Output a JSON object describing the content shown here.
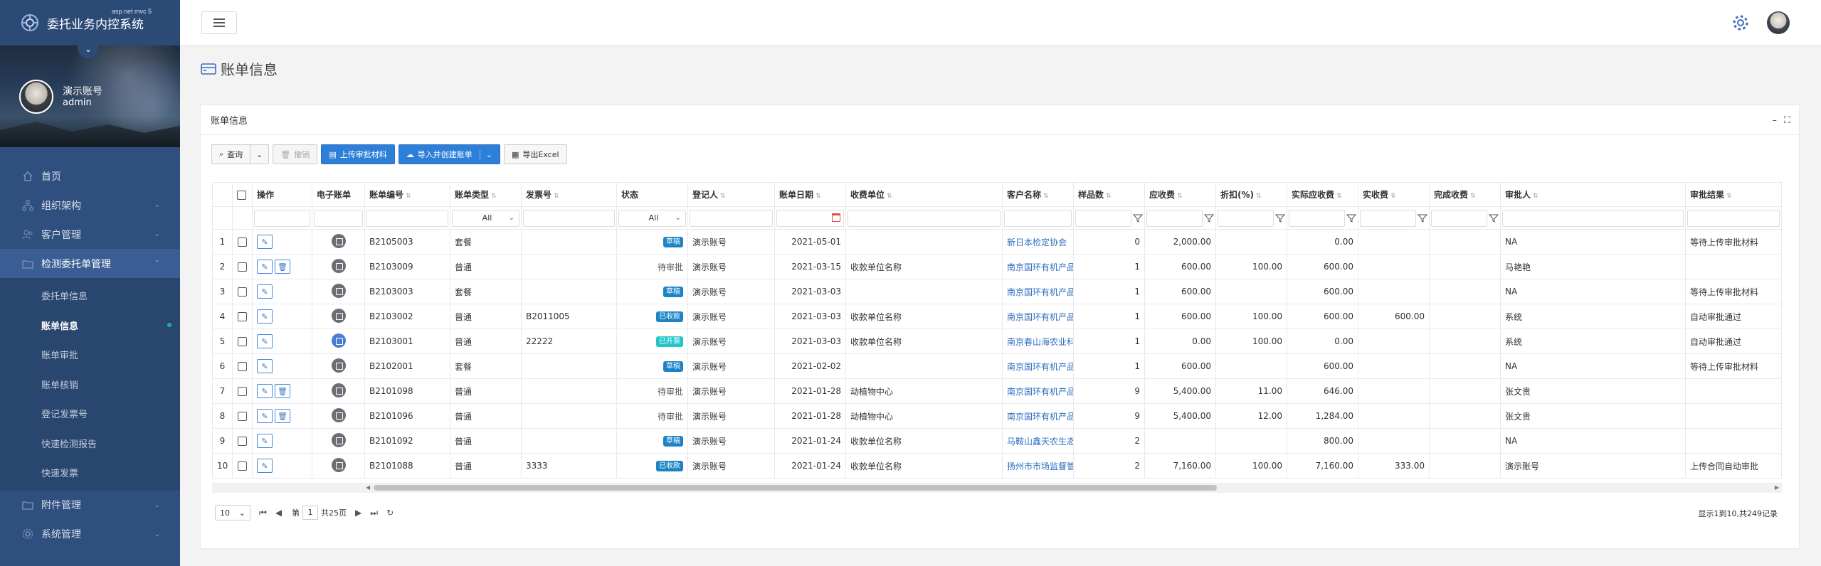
{
  "brand": {
    "title": "委托业务内控系统",
    "subtitle": "asp.net mvc 5"
  },
  "user": {
    "name": "演示账号",
    "role": "admin"
  },
  "sidebar": {
    "items": [
      {
        "label": "首页",
        "icon": "home-icon"
      },
      {
        "label": "组织架构",
        "icon": "org-icon"
      },
      {
        "label": "客户管理",
        "icon": "customer-icon"
      },
      {
        "label": "检测委托单管理",
        "icon": "folder-icon"
      }
    ],
    "sub_items": [
      "委托单信息",
      "账单信息",
      "账单审批",
      "账单核销",
      "登记发票号",
      "快速检测报告",
      "快速发票"
    ],
    "bottom_items": [
      {
        "label": "附件管理",
        "icon": "attachment-icon"
      },
      {
        "label": "系统管理",
        "icon": "settings-icon"
      }
    ]
  },
  "page": {
    "title": "账单信息",
    "card_title": "账单信息"
  },
  "toolbar": {
    "query": "查询",
    "revoke": "撤销",
    "upload": "上传审批材料",
    "import": "导入并创建账单",
    "export": "导出Excel"
  },
  "table": {
    "headers": [
      "操作",
      "电子账单",
      "账单编号",
      "账单类型",
      "发票号",
      "状态",
      "登记人",
      "账单日期",
      "收费单位",
      "客户名称",
      "样品数",
      "应收费",
      "折扣(%)",
      "实际应收费",
      "实收费",
      "完成收费",
      "审批人",
      "审批结果"
    ],
    "filters": {
      "type": "All",
      "status": "All"
    },
    "rows": [
      {
        "no": "1",
        "code": "B2105003",
        "type": "套餐",
        "invoice": "",
        "status": "草稿",
        "status_kind": "blue",
        "registrant": "演示账号",
        "date": "2021-05-01",
        "unit": "",
        "customer": "新日本检定协会",
        "samples": "0",
        "receivable": "2,000.00",
        "discount": "",
        "actual_receivable": "0.00",
        "received": "",
        "done": "",
        "approver": "NA",
        "result": "等待上传审批材料",
        "ebill": "gray",
        "actions": 1
      },
      {
        "no": "2",
        "code": "B2103009",
        "type": "普通",
        "invoice": "",
        "status": "待审批",
        "status_kind": "plain",
        "registrant": "演示账号",
        "date": "2021-03-15",
        "unit": "收款单位名称",
        "customer": "南京国环有机产品认证中心",
        "samples": "1",
        "receivable": "600.00",
        "discount": "100.00",
        "actual_receivable": "600.00",
        "received": "",
        "done": "",
        "approver": "马艳艳",
        "result": "",
        "ebill": "gray",
        "actions": 2
      },
      {
        "no": "3",
        "code": "B2103003",
        "type": "套餐",
        "invoice": "",
        "status": "草稿",
        "status_kind": "blue",
        "registrant": "演示账号",
        "date": "2021-03-03",
        "unit": "",
        "customer": "南京国环有机产品认证中心",
        "samples": "1",
        "receivable": "600.00",
        "discount": "",
        "actual_receivable": "600.00",
        "received": "",
        "done": "",
        "approver": "NA",
        "result": "等待上传审批材料",
        "ebill": "gray",
        "actions": 1
      },
      {
        "no": "4",
        "code": "B2103002",
        "type": "普通",
        "invoice": "B2011005",
        "status": "已收款",
        "status_kind": "blue",
        "registrant": "演示账号",
        "date": "2021-03-03",
        "unit": "收款单位名称",
        "customer": "南京国环有机产品认证中心",
        "samples": "1",
        "receivable": "600.00",
        "discount": "100.00",
        "actual_receivable": "600.00",
        "received": "600.00",
        "done": "",
        "approver": "系统",
        "result": "自动审批通过",
        "ebill": "gray",
        "actions": 1
      },
      {
        "no": "5",
        "code": "B2103001",
        "type": "普通",
        "invoice": "22222",
        "status": "已开票",
        "status_kind": "teal",
        "registrant": "演示账号",
        "date": "2021-03-03",
        "unit": "收款单位名称",
        "customer": "南京春山海农业科技有限公司",
        "samples": "1",
        "receivable": "0.00",
        "discount": "100.00",
        "actual_receivable": "0.00",
        "received": "",
        "done": "",
        "approver": "系统",
        "result": "自动审批通过",
        "ebill": "blue",
        "actions": 1
      },
      {
        "no": "6",
        "code": "B2102001",
        "type": "套餐",
        "invoice": "",
        "status": "草稿",
        "status_kind": "blue",
        "registrant": "演示账号",
        "date": "2021-02-02",
        "unit": "",
        "customer": "南京国环有机产品认证中心",
        "samples": "1",
        "receivable": "600.00",
        "discount": "",
        "actual_receivable": "600.00",
        "received": "",
        "done": "",
        "approver": "NA",
        "result": "等待上传审批材料",
        "ebill": "gray",
        "actions": 1
      },
      {
        "no": "7",
        "code": "B2101098",
        "type": "普通",
        "invoice": "",
        "status": "待审批",
        "status_kind": "plain",
        "registrant": "演示账号",
        "date": "2021-01-28",
        "unit": "动植物中心",
        "customer": "南京国环有机产品认证中心",
        "samples": "9",
        "receivable": "5,400.00",
        "discount": "11.00",
        "actual_receivable": "646.00",
        "received": "",
        "done": "",
        "approver": "张文贵",
        "result": "",
        "ebill": "gray",
        "actions": 2
      },
      {
        "no": "8",
        "code": "B2101096",
        "type": "普通",
        "invoice": "",
        "status": "待审批",
        "status_kind": "plain",
        "registrant": "演示账号",
        "date": "2021-01-28",
        "unit": "动植物中心",
        "customer": "南京国环有机产品认证中心",
        "samples": "9",
        "receivable": "5,400.00",
        "discount": "12.00",
        "actual_receivable": "1,284.00",
        "received": "",
        "done": "",
        "approver": "张文贵",
        "result": "",
        "ebill": "gray",
        "actions": 2
      },
      {
        "no": "9",
        "code": "B2101092",
        "type": "普通",
        "invoice": "",
        "status": "草稿",
        "status_kind": "blue",
        "registrant": "演示账号",
        "date": "2021-01-24",
        "unit": "收款单位名称",
        "customer": "马鞍山鑫天农生态农业有限公司",
        "samples": "2",
        "receivable": "",
        "discount": "",
        "actual_receivable": "800.00",
        "received": "",
        "done": "",
        "approver": "NA",
        "result": "",
        "ebill": "gray",
        "actions": 1
      },
      {
        "no": "10",
        "code": "B2101088",
        "type": "普通",
        "invoice": "3333",
        "status": "已收款",
        "status_kind": "blue",
        "registrant": "演示账号",
        "date": "2021-01-24",
        "unit": "收款单位名称",
        "customer": "扬州市市场监督管理局",
        "samples": "2",
        "receivable": "7,160.00",
        "discount": "100.00",
        "actual_receivable": "7,160.00",
        "received": "333.00",
        "done": "",
        "approver": "演示账号",
        "result": "上传合同自动审批",
        "ebill": "gray",
        "actions": 1
      }
    ]
  },
  "pager": {
    "page_size": "10",
    "page_prefix": "第",
    "page": "1",
    "total_pages": "共25页",
    "info": "显示1到10,共249记录"
  },
  "colors": {
    "sidebar": "#2f4f7f",
    "primary": "#2d7fd8",
    "link": "#2d6dbf",
    "badge_blue": "#1c84c6",
    "badge_teal": "#23c6c8"
  }
}
